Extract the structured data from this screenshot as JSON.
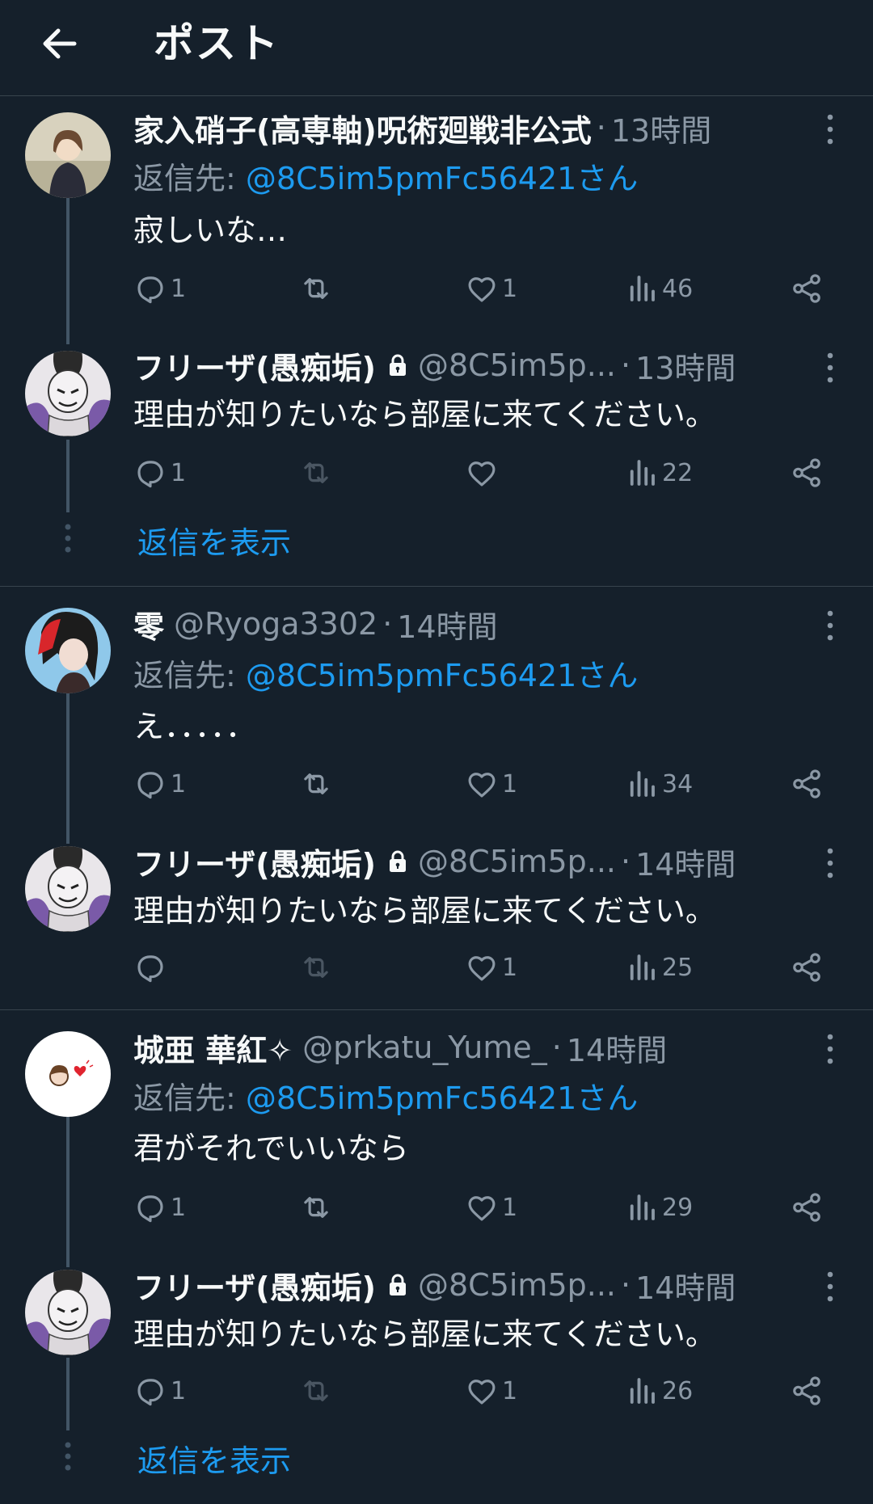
{
  "header": {
    "title": "ポスト"
  },
  "reply_prefix": "返信先:",
  "show_replies_label": "返信を表示",
  "colors": {
    "background": "#15202b",
    "accent": "#1d9bf0",
    "secondary": "#8b98a5",
    "divider": "#38444d"
  },
  "groups": [
    {
      "first": {
        "name": "家入硝子(高専軸)呪術廻戦非公式",
        "handle": "",
        "time": "13時間",
        "reply_to": "@8C5im5pmFc56421さん",
        "text": "寂しいな…",
        "counts": {
          "reply": "1",
          "retweet": "",
          "like": "1",
          "views": "46"
        }
      },
      "second": {
        "name": "フリーザ(愚痴垢)",
        "handle": "@8C5im5p...",
        "time": "13時間",
        "text": "理由が知りたいなら部屋に来てください。",
        "counts": {
          "reply": "1",
          "retweet": "",
          "like": "",
          "views": "22"
        }
      }
    },
    {
      "first": {
        "name": "零",
        "handle": "@Ryoga3302",
        "time": "14時間",
        "reply_to": "@8C5im5pmFc56421さん",
        "text": "え．．．．．",
        "counts": {
          "reply": "1",
          "retweet": "",
          "like": "1",
          "views": "34"
        }
      },
      "second": {
        "name": "フリーザ(愚痴垢)",
        "handle": "@8C5im5p...",
        "time": "14時間",
        "text": "理由が知りたいなら部屋に来てください。",
        "counts": {
          "reply": "",
          "retweet": "",
          "like": "1",
          "views": "25"
        }
      }
    },
    {
      "first": {
        "name": "城亜 華紅✧",
        "handle": "@prkatu_Yume_",
        "time": "14時間",
        "reply_to": "@8C5im5pmFc56421さん",
        "text": "君がそれでいいなら",
        "counts": {
          "reply": "1",
          "retweet": "",
          "like": "1",
          "views": "29"
        }
      },
      "second": {
        "name": "フリーザ(愚痴垢)",
        "handle": "@8C5im5p...",
        "time": "14時間",
        "text": "理由が知りたいなら部屋に来てください。",
        "counts": {
          "reply": "1",
          "retweet": "",
          "like": "1",
          "views": "26"
        }
      }
    }
  ]
}
